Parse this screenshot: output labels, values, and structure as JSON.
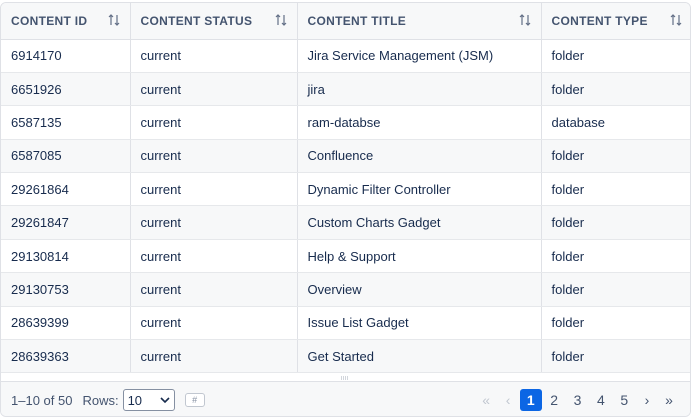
{
  "columns": [
    {
      "label": "CONTENT ID"
    },
    {
      "label": "CONTENT STATUS"
    },
    {
      "label": "CONTENT TITLE"
    },
    {
      "label": "CONTENT TYPE"
    }
  ],
  "rows": [
    [
      "6914170",
      "current",
      "Jira Service Management (JSM)",
      "folder"
    ],
    [
      "6651926",
      "current",
      "jira",
      "folder"
    ],
    [
      "6587135",
      "current",
      "ram-databse",
      "database"
    ],
    [
      "6587085",
      "current",
      "Confluence",
      "folder"
    ],
    [
      "29261864",
      "current",
      "Dynamic Filter Controller",
      "folder"
    ],
    [
      "29261847",
      "current",
      "Custom Charts Gadget",
      "folder"
    ],
    [
      "29130814",
      "current",
      "Help & Support",
      "folder"
    ],
    [
      "29130753",
      "current",
      "Overview",
      "folder"
    ],
    [
      "28639399",
      "current",
      "Issue List Gadget",
      "folder"
    ],
    [
      "28639363",
      "current",
      "Get Started",
      "folder"
    ]
  ],
  "footer": {
    "range": "1–10 of 50",
    "rows_label": "Rows:",
    "rows_value": "10",
    "jump_label": "#",
    "first": "«",
    "prev": "‹",
    "next": "›",
    "last": "»",
    "pages": [
      "1",
      "2",
      "3",
      "4",
      "5"
    ],
    "current_page": "1"
  },
  "colors": {
    "accent": "#0c66e4"
  }
}
